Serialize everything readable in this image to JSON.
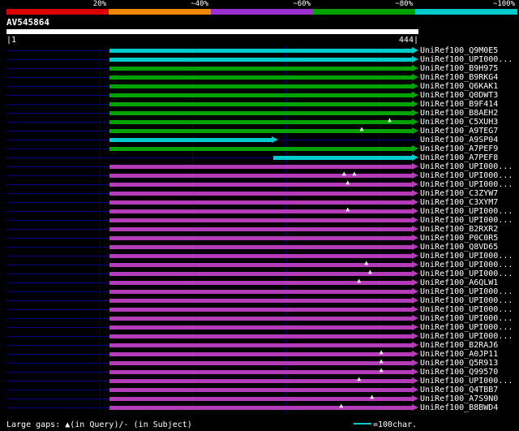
{
  "colors": {
    "background": "#000000",
    "text": "#ffffff",
    "uncovered_line": "#000080",
    "grid_line": "#000060",
    "bar_colors": {
      "cyan": "#00cccc",
      "green": "#00a300",
      "purple": "#b43cb8"
    }
  },
  "identity_scale": {
    "labels": [
      "20%",
      "~40%",
      "~60%",
      "~80%",
      "~100%"
    ],
    "segment_colors": [
      "#dd0000",
      "#ee8800",
      "#9b30d0",
      "#00a000",
      "#00cccc"
    ]
  },
  "query": {
    "name": "AV545864",
    "length": 444,
    "start_tick": "|1",
    "end_tick": "444|"
  },
  "legend": {
    "gaps": "Large gaps: ▲(in Query)/- (in Subject)",
    "gap_marker_glyph": "▲",
    "unit": "=100char.",
    "unit_line_color": "#00cccc"
  },
  "chart_data": {
    "type": "bar",
    "orientation": "horizontal",
    "title": "BLAST hit overview for query AV545864",
    "x_range": [
      1,
      444
    ],
    "grid_interval_chars": 100,
    "rows": [
      {
        "label": "UniRef100_Q9M0E5",
        "color": "cyan",
        "q_start": 112,
        "q_end": 444,
        "gaps": []
      },
      {
        "label": "UniRef100_UPI000...",
        "color": "cyan",
        "q_start": 112,
        "q_end": 444,
        "gaps": []
      },
      {
        "label": "UniRef100_B9H975",
        "color": "green",
        "q_start": 112,
        "q_end": 444,
        "gaps": []
      },
      {
        "label": "UniRef100_B9RKG4",
        "color": "green",
        "q_start": 112,
        "q_end": 444,
        "gaps": []
      },
      {
        "label": "UniRef100_Q6KAK1",
        "color": "green",
        "q_start": 112,
        "q_end": 444,
        "gaps": []
      },
      {
        "label": "UniRef100_Q0DWT3",
        "color": "green",
        "q_start": 112,
        "q_end": 444,
        "gaps": []
      },
      {
        "label": "UniRef100_B9F414",
        "color": "green",
        "q_start": 112,
        "q_end": 444,
        "gaps": []
      },
      {
        "label": "UniRef100_B8AEH2",
        "color": "green",
        "q_start": 112,
        "q_end": 444,
        "gaps": []
      },
      {
        "label": "UniRef100_C5XUH3",
        "color": "green",
        "q_start": 112,
        "q_end": 444,
        "gaps": [
          413
        ]
      },
      {
        "label": "UniRef100_A9TEG7",
        "color": "green",
        "q_start": 112,
        "q_end": 444,
        "gaps": [
          383
        ]
      },
      {
        "label": "UniRef100_A9SP04",
        "color": "cyan",
        "q_start": 112,
        "q_end": 293,
        "gaps": []
      },
      {
        "label": "UniRef100_A7PEF9",
        "color": "green",
        "q_start": 112,
        "q_end": 444,
        "gaps": []
      },
      {
        "label": "UniRef100_A7PEF8",
        "color": "cyan",
        "q_start": 288,
        "q_end": 444,
        "gaps": []
      },
      {
        "label": "UniRef100_UPI000...",
        "color": "purple",
        "q_start": 112,
        "q_end": 444,
        "gaps": []
      },
      {
        "label": "UniRef100_UPI000...",
        "color": "purple",
        "q_start": 112,
        "q_end": 444,
        "gaps": [
          364,
          375
        ]
      },
      {
        "label": "UniRef100_UPI000...",
        "color": "purple",
        "q_start": 112,
        "q_end": 444,
        "gaps": [
          368
        ]
      },
      {
        "label": "UniRef100_C3ZYW7",
        "color": "purple",
        "q_start": 112,
        "q_end": 444,
        "gaps": []
      },
      {
        "label": "UniRef100_C3XYM7",
        "color": "purple",
        "q_start": 112,
        "q_end": 444,
        "gaps": []
      },
      {
        "label": "UniRef100_UPI000...",
        "color": "purple",
        "q_start": 112,
        "q_end": 444,
        "gaps": [
          368
        ]
      },
      {
        "label": "UniRef100_UPI000...",
        "color": "purple",
        "q_start": 112,
        "q_end": 444,
        "gaps": []
      },
      {
        "label": "UniRef100_B2RXR2",
        "color": "purple",
        "q_start": 112,
        "q_end": 444,
        "gaps": []
      },
      {
        "label": "UniRef100_P0C0R5",
        "color": "purple",
        "q_start": 112,
        "q_end": 444,
        "gaps": []
      },
      {
        "label": "UniRef100_Q8VD65",
        "color": "purple",
        "q_start": 112,
        "q_end": 444,
        "gaps": []
      },
      {
        "label": "UniRef100_UPI000...",
        "color": "purple",
        "q_start": 112,
        "q_end": 444,
        "gaps": []
      },
      {
        "label": "UniRef100_UPI000...",
        "color": "purple",
        "q_start": 112,
        "q_end": 444,
        "gaps": [
          388
        ]
      },
      {
        "label": "UniRef100_UPI000...",
        "color": "purple",
        "q_start": 112,
        "q_end": 444,
        "gaps": [
          392
        ]
      },
      {
        "label": "UniRef100_A6QLW1",
        "color": "purple",
        "q_start": 112,
        "q_end": 444,
        "gaps": [
          380
        ]
      },
      {
        "label": "UniRef100_UPI000...",
        "color": "purple",
        "q_start": 112,
        "q_end": 444,
        "gaps": []
      },
      {
        "label": "UniRef100_UPI000...",
        "color": "purple",
        "q_start": 112,
        "q_end": 444,
        "gaps": []
      },
      {
        "label": "UniRef100_UPI000...",
        "color": "purple",
        "q_start": 112,
        "q_end": 444,
        "gaps": []
      },
      {
        "label": "UniRef100_UPI000...",
        "color": "purple",
        "q_start": 112,
        "q_end": 444,
        "gaps": []
      },
      {
        "label": "UniRef100_UPI000...",
        "color": "purple",
        "q_start": 112,
        "q_end": 444,
        "gaps": []
      },
      {
        "label": "UniRef100_UPI000...",
        "color": "purple",
        "q_start": 112,
        "q_end": 444,
        "gaps": []
      },
      {
        "label": "UniRef100_B2RAJ6",
        "color": "purple",
        "q_start": 112,
        "q_end": 444,
        "gaps": []
      },
      {
        "label": "UniRef100_A0JP11",
        "color": "purple",
        "q_start": 112,
        "q_end": 444,
        "gaps": [
          404
        ]
      },
      {
        "label": "UniRef100_Q5R913",
        "color": "purple",
        "q_start": 112,
        "q_end": 444,
        "gaps": [
          404
        ]
      },
      {
        "label": "UniRef100_Q99570",
        "color": "purple",
        "q_start": 112,
        "q_end": 444,
        "gaps": [
          404
        ]
      },
      {
        "label": "UniRef100_UPI000...",
        "color": "purple",
        "q_start": 112,
        "q_end": 444,
        "gaps": [
          380
        ]
      },
      {
        "label": "UniRef100_Q4TBB7",
        "color": "purple",
        "q_start": 112,
        "q_end": 444,
        "gaps": []
      },
      {
        "label": "UniRef100_A7S9N0",
        "color": "purple",
        "q_start": 112,
        "q_end": 444,
        "gaps": [
          394
        ]
      },
      {
        "label": "UniRef100_B8BWD4",
        "color": "purple",
        "q_start": 112,
        "q_end": 444,
        "gaps": [
          361
        ]
      }
    ]
  }
}
